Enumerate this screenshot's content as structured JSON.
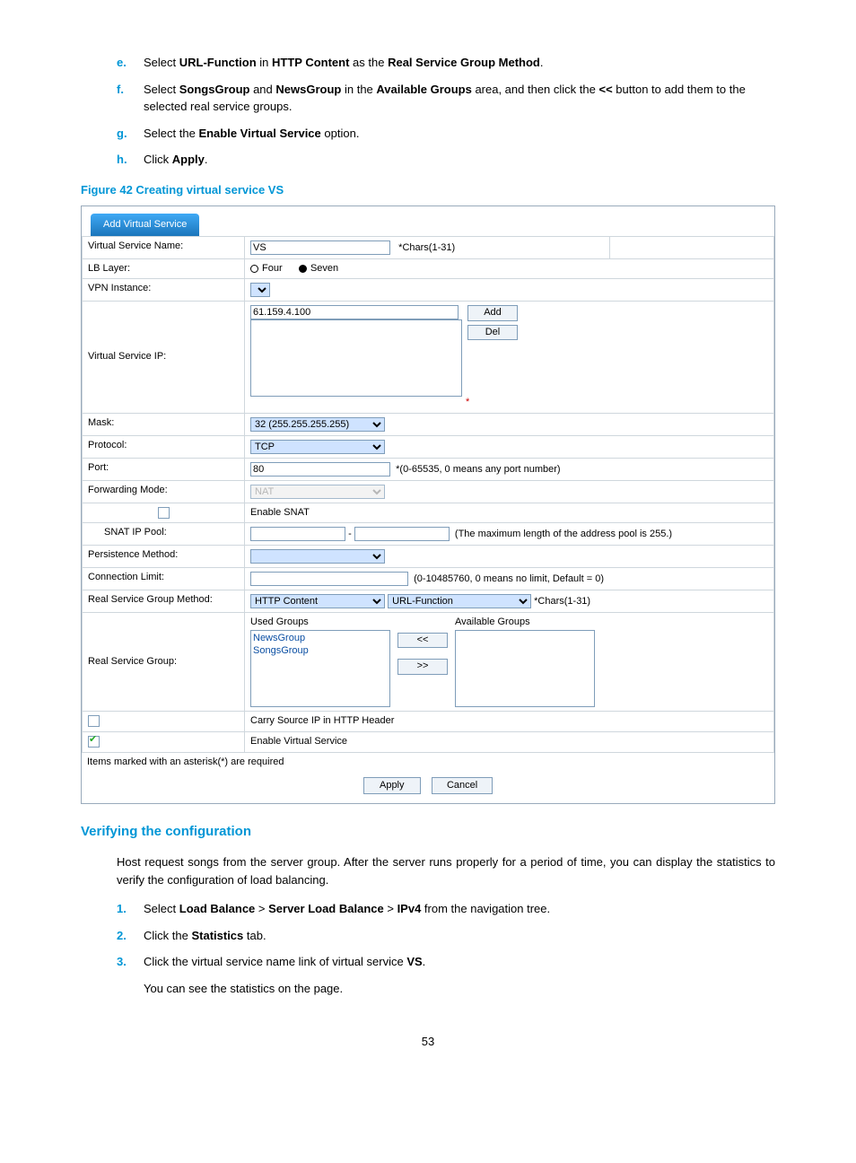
{
  "steps_top": [
    {
      "m": "e.",
      "pre": "Select ",
      "b1": "URL-Function",
      "mid1": " in ",
      "b2": "HTTP Content",
      "mid2": " as the ",
      "b3": "Real Service Group Method",
      "suf": "."
    },
    {
      "m": "f.",
      "pre": "Select ",
      "b1": "SongsGroup",
      "mid1": " and ",
      "b2": "NewsGroup",
      "mid2": " in the ",
      "b3": "Available Groups",
      "mid3": " area, and then click the ",
      "b4": "<<",
      "suf": " button to add them to the selected real service groups."
    },
    {
      "m": "g.",
      "pre": "Select the ",
      "b1": "Enable Virtual Service",
      "suf": " option."
    },
    {
      "m": "h.",
      "pre": "Click ",
      "b1": "Apply",
      "suf": "."
    }
  ],
  "fig_caption": "Figure 42 Creating virtual service VS",
  "tab_label": "Add Virtual Service",
  "form": {
    "vs_name_lbl": "Virtual Service Name:",
    "vs_name_val": "VS",
    "vs_name_hint": "*Chars(1-31)",
    "lb_layer_lbl": "LB Layer:",
    "lb_four": "Four",
    "lb_seven": "Seven",
    "vpn_lbl": "VPN Instance:",
    "vip_lbl": "Virtual Service IP:",
    "vip_val": "61.159.4.100",
    "btn_add": "Add",
    "btn_del": "Del",
    "mask_lbl": "Mask:",
    "mask_val": "32 (255.255.255.255)",
    "proto_lbl": "Protocol:",
    "proto_val": "TCP",
    "port_lbl": "Port:",
    "port_val": "80",
    "port_hint": "*(0-65535, 0 means any port number)",
    "fwd_lbl": "Forwarding Mode:",
    "fwd_val": "NAT",
    "snat_enable": "Enable SNAT",
    "snat_pool_lbl": "SNAT IP Pool:",
    "snat_sep": "-",
    "snat_hint": "(The maximum length of the address pool is 255.)",
    "persist_lbl": "Persistence Method:",
    "connlim_lbl": "Connection Limit:",
    "connlim_hint": "(0-10485760, 0 means no limit, Default = 0)",
    "rsgm_lbl": "Real Service Group Method:",
    "rsgm_sel1": "HTTP Content",
    "rsgm_sel2": "URL-Function",
    "rsgm_hint": "*Chars(1-31)",
    "rsg_lbl": "Real Service Group:",
    "used_hdr": "Used Groups",
    "avail_hdr": "Available Groups",
    "used_item1": "NewsGroup",
    "used_item2": "SongsGroup",
    "move_l": "<<",
    "move_r": ">>",
    "carry_lbl": "Carry Source IP in HTTP Header",
    "enable_vs": "Enable Virtual Service",
    "req_note": "Items marked with an asterisk(*) are required",
    "btn_apply": "Apply",
    "btn_cancel": "Cancel"
  },
  "verify_hdr": "Verifying the configuration",
  "verify_para": "Host request songs from the server group. After the server runs properly for a period of time, you can display the statistics to verify the configuration of load balancing.",
  "steps_bottom": [
    {
      "m": "1.",
      "pre": "Select ",
      "b1": "Load Balance",
      "mid1": " > ",
      "b2": "Server Load Balance",
      "mid2": " > ",
      "b3": "IPv4",
      "suf": " from the navigation tree."
    },
    {
      "m": "2.",
      "pre": "Click the ",
      "b1": "Statistics",
      "suf": " tab."
    },
    {
      "m": "3.",
      "pre": "Click the virtual service name link of virtual service ",
      "b1": "VS",
      "suf": "."
    }
  ],
  "verify_tail": "You can see the statistics on the page.",
  "page_num": "53"
}
